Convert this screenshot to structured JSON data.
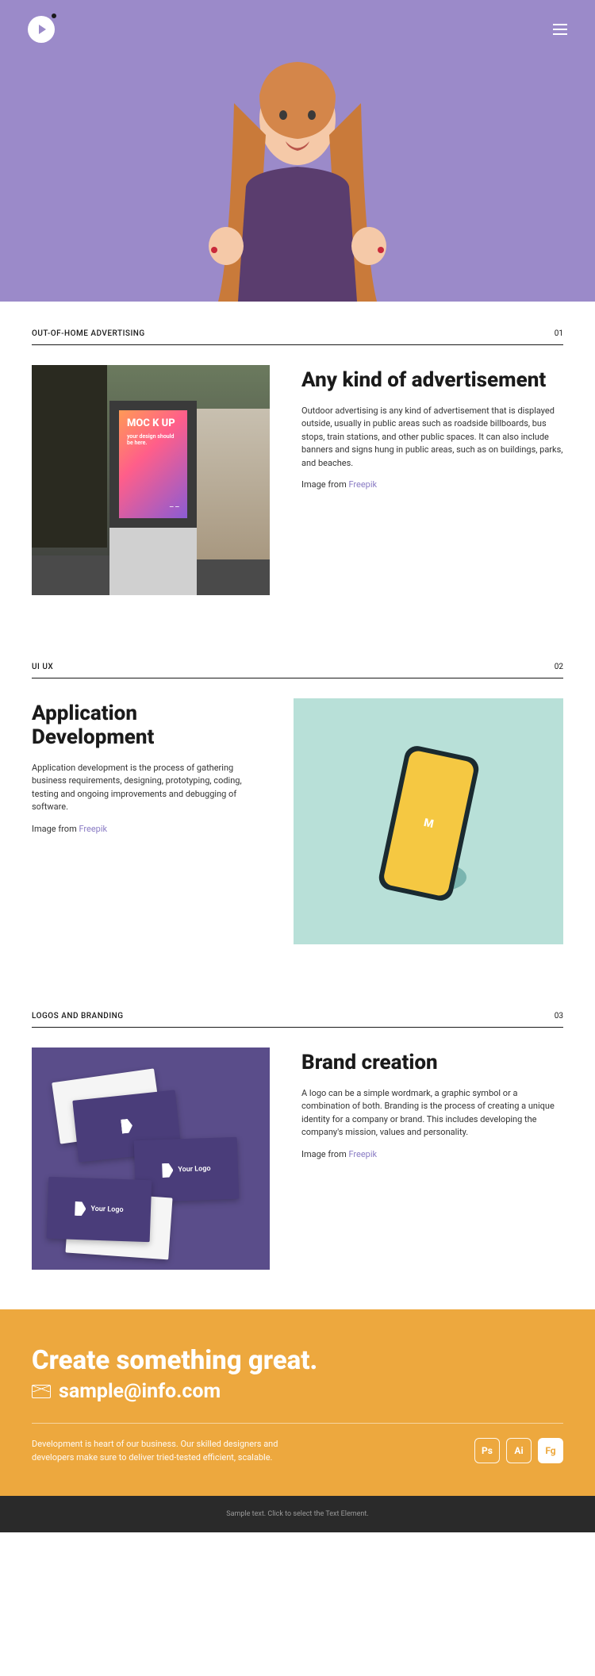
{
  "sections": [
    {
      "tag": "OUT-OF-HOME ADVERTISING",
      "num": "01",
      "title": "Any kind of advertisement",
      "desc": "Outdoor advertising is any kind of advertisement that is displayed outside, usually in public areas such as roadside billboards, bus stops, train stations, and other public spaces. It can also include banners and signs hung in public areas, such as on buildings, parks, and beaches.",
      "credit_prefix": "Image from ",
      "credit_link": "Freepik",
      "sign_top": "MOC K UP",
      "sign_sub": "your design should be here."
    },
    {
      "tag": "UI UX",
      "num": "02",
      "title": "Application Development",
      "desc": "Application development is the process of gathering business requirements, designing, prototyping, coding, testing and ongoing improvements and debugging of software.",
      "credit_prefix": "Image from ",
      "credit_link": "Freepik"
    },
    {
      "tag": "LOGOS AND BRANDING",
      "num": "03",
      "title": "Brand creation",
      "desc": "A logo can be a simple wordmark, a graphic symbol or a combination of both. Branding is the process of creating a unique identity for a company or brand. This includes developing the company's mission, values and personality.",
      "credit_prefix": "Image from ",
      "credit_link": "Freepik",
      "card_label": "Your Logo"
    }
  ],
  "cta": {
    "title": "Create something great.",
    "email": "sample@info.com",
    "desc": "Development is heart of our business. Our skilled designers and developers make sure to deliver tried-tested efficient, scalable.",
    "icons": [
      "Ps",
      "Ai",
      "Fg"
    ]
  },
  "footer": {
    "text": "Sample text. Click to select the Text Element."
  }
}
